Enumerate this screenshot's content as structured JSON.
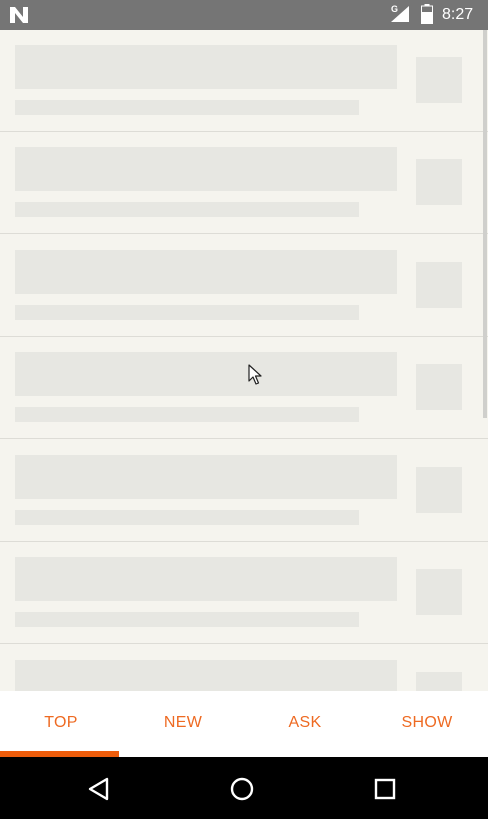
{
  "status_bar": {
    "network_type": "G",
    "time": "8:27",
    "icons": [
      "notification-n-icon",
      "cell-signal-icon",
      "battery-icon"
    ]
  },
  "list": {
    "state": "loading-placeholders",
    "placeholder_row_count": 7
  },
  "tabs": [
    {
      "label": "TOP",
      "active": true
    },
    {
      "label": "NEW",
      "active": false
    },
    {
      "label": "ASK",
      "active": false
    },
    {
      "label": "SHOW",
      "active": false
    }
  ],
  "nav_bar": {
    "icons": [
      "back-icon",
      "home-icon",
      "recent-apps-icon"
    ]
  },
  "colors": {
    "accent": "#ee6a22",
    "indicator": "#ee5d0c",
    "background": "#f5f4ee",
    "placeholder": "#e7e7e2",
    "status_bar": "#757575"
  }
}
